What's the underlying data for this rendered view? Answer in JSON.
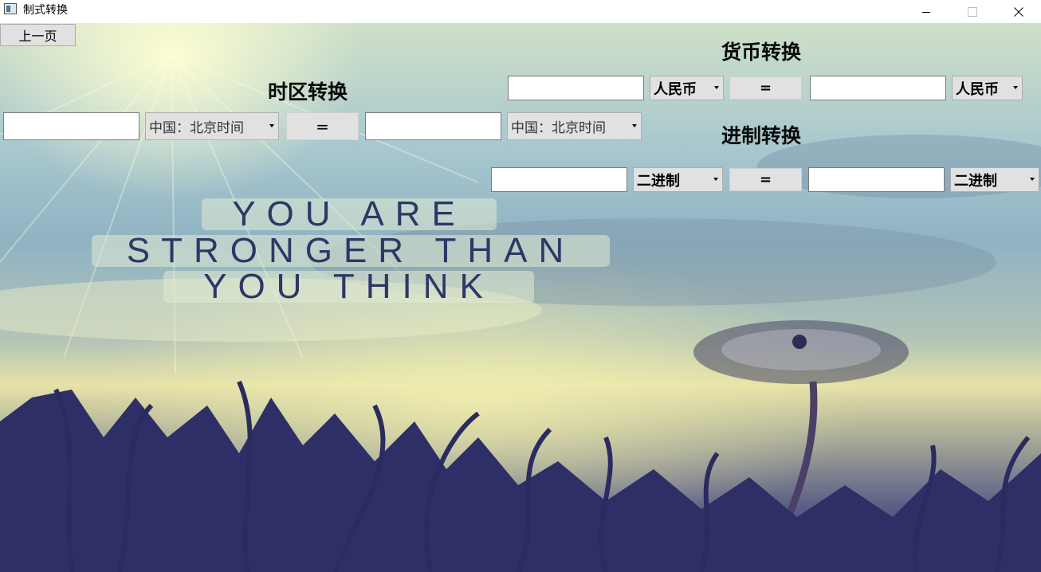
{
  "window": {
    "title": "制式转换",
    "icon": "app-icon"
  },
  "nav": {
    "back_label": "上一页"
  },
  "timezone": {
    "title": "时区转换",
    "from_value": "",
    "from_unit": "中国：北京时间",
    "equals": "=",
    "to_value": "",
    "to_unit": "中国：北京时间"
  },
  "currency": {
    "title": "货币转换",
    "from_value": "",
    "from_unit": "人民币",
    "equals": "=",
    "to_value": "",
    "to_unit": "人民币"
  },
  "base": {
    "title": "进制转换",
    "from_value": "",
    "from_unit": "二进制",
    "equals": "=",
    "to_value": "",
    "to_unit": "二进制"
  },
  "background_quote": [
    "YOU ARE",
    "STRONGER THAN",
    "YOU THINK"
  ]
}
